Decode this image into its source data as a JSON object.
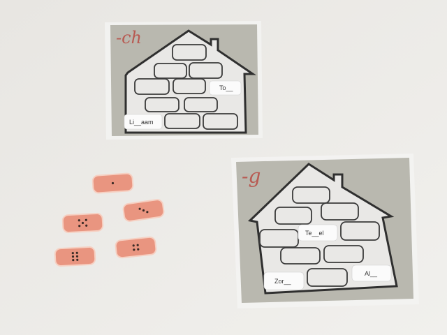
{
  "cards": [
    {
      "heading": "-ch",
      "labels": [
        "To__",
        "Li__aam"
      ]
    },
    {
      "heading": "-g",
      "labels": [
        "Te__el",
        "Zor__",
        "Al__"
      ]
    }
  ],
  "dice_bandages": [
    1,
    3,
    5,
    4,
    6
  ],
  "colors": {
    "background": "#eeece8",
    "card": "#b9b8af",
    "house": "#e9e8e6",
    "bandage": "#e99580",
    "heading": "#b85a52"
  }
}
